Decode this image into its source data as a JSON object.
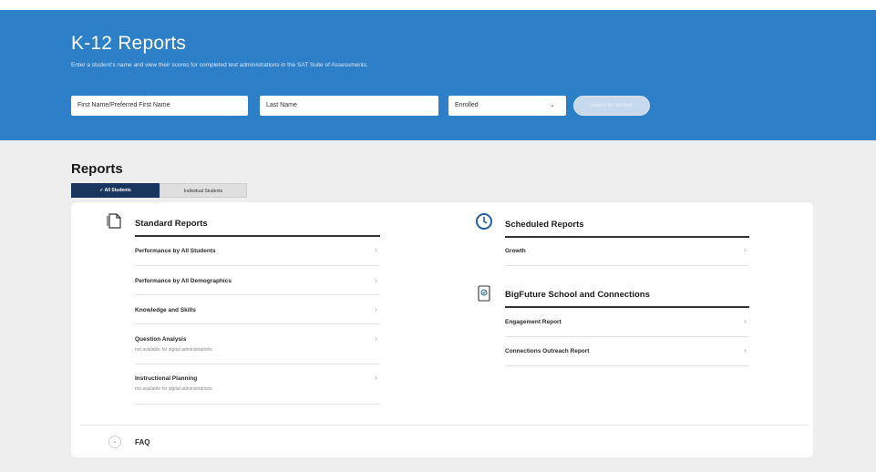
{
  "header": {
    "title": "K-12 Reports",
    "subtitle": "Enter a student's name and view their scores for completed test administrations in the SAT Suite of Assessments."
  },
  "search": {
    "first_name_placeholder": "First Name/Preferred First Name",
    "last_name_placeholder": "Last Name",
    "status_value": "Enrolled",
    "search_button": "Search for Student"
  },
  "reports": {
    "title": "Reports",
    "tabs": [
      {
        "label": "All Students",
        "selected": true
      },
      {
        "label": "Individual Students",
        "selected": false
      }
    ]
  },
  "standard_reports": {
    "heading": "Standard Reports",
    "items": [
      {
        "label": "Performance by All Students",
        "note": ""
      },
      {
        "label": "Performance by All Demographics",
        "note": ""
      },
      {
        "label": "Knowledge and Skills",
        "note": ""
      },
      {
        "label": "Question Analysis",
        "note": "not available for digital administrations"
      },
      {
        "label": "Instructional Planning",
        "note": "not available for digital administrations"
      }
    ]
  },
  "scheduled_reports": {
    "heading": "Scheduled Reports",
    "items": [
      {
        "label": "Growth"
      }
    ]
  },
  "bigfuture": {
    "heading": "BigFuture School and Connections",
    "items": [
      {
        "label": "Engagement Report"
      },
      {
        "label": "Connections Outreach Report"
      }
    ]
  },
  "faq": {
    "label": "FAQ"
  },
  "glyphs": {
    "check": "✓",
    "chevron_right": "›",
    "chevron_down": "⌄"
  },
  "colors": {
    "header_blue": "#2d7fc8",
    "tab_active": "#1a355e",
    "page_bg": "#eeeeef"
  },
  "icons": {
    "standard_reports": "document-icon",
    "scheduled_reports": "clock-icon",
    "bigfuture": "notebook-icon"
  }
}
